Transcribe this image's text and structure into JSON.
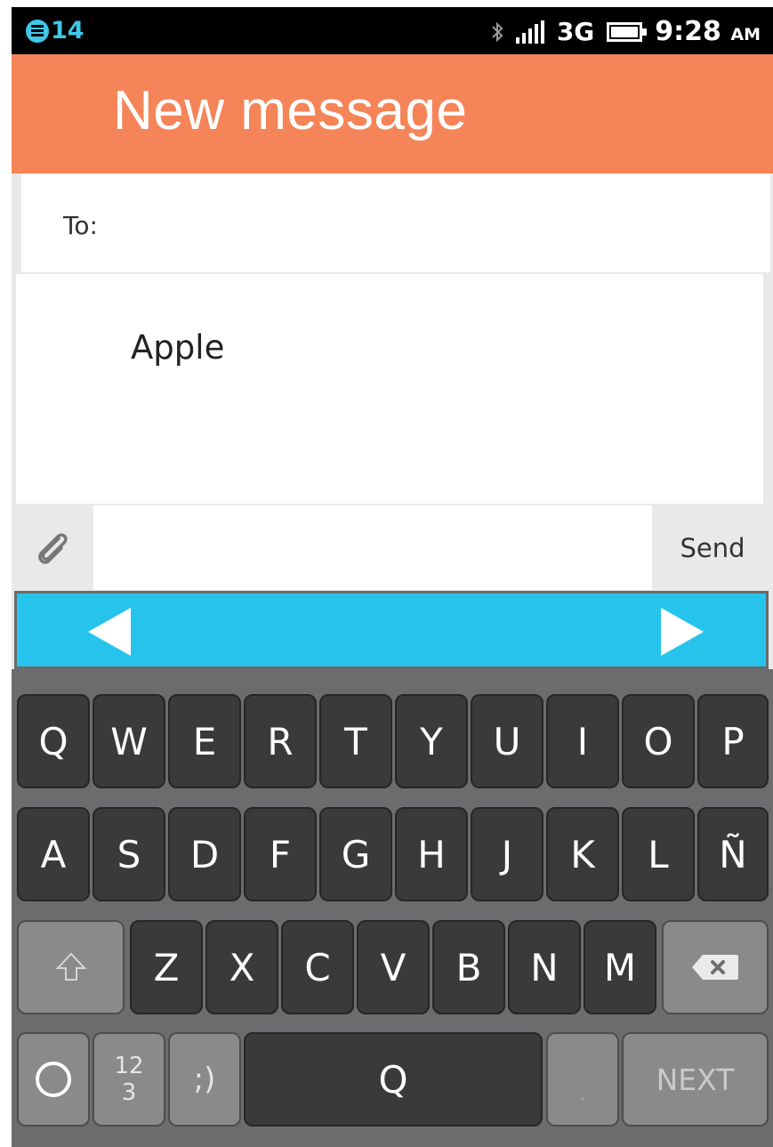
{
  "status_bar": {
    "notification_count": "14",
    "network": "3G",
    "time": "9:28",
    "ampm": "AM",
    "icons": [
      "notification-icon",
      "bluetooth-icon",
      "signal-icon",
      "battery-icon"
    ]
  },
  "header": {
    "title": "New message"
  },
  "compose": {
    "to_label": "To:",
    "message_text": "Apple",
    "send_label": "Send",
    "attach_icon": "paperclip-icon"
  },
  "suggestions": {
    "prev_icon": "left-arrow-icon",
    "next_icon": "right-arrow-icon"
  },
  "keyboard": {
    "row1": [
      "Q",
      "W",
      "E",
      "R",
      "T",
      "Y",
      "U",
      "I",
      "O",
      "P"
    ],
    "row2": [
      "A",
      "S",
      "D",
      "F",
      "G",
      "H",
      "J",
      "K",
      "L",
      "Ñ"
    ],
    "row3": [
      "Z",
      "X",
      "C",
      "V",
      "B",
      "N",
      "M"
    ],
    "shift_icon": "shift-icon",
    "backspace_icon": "backspace-icon",
    "globe_icon": "circle-icon",
    "num_line1": "12",
    "num_line2": "3",
    "smiley": ";)",
    "space_label": "Q",
    "period": ".",
    "next_label": "NEXT"
  },
  "colors": {
    "header": "#f58558",
    "suggest_bar": "#26c4ec",
    "keyboard_bg": "#6c6c6e",
    "key": "#3a3a3b",
    "key_alt": "#8a8a8d"
  }
}
